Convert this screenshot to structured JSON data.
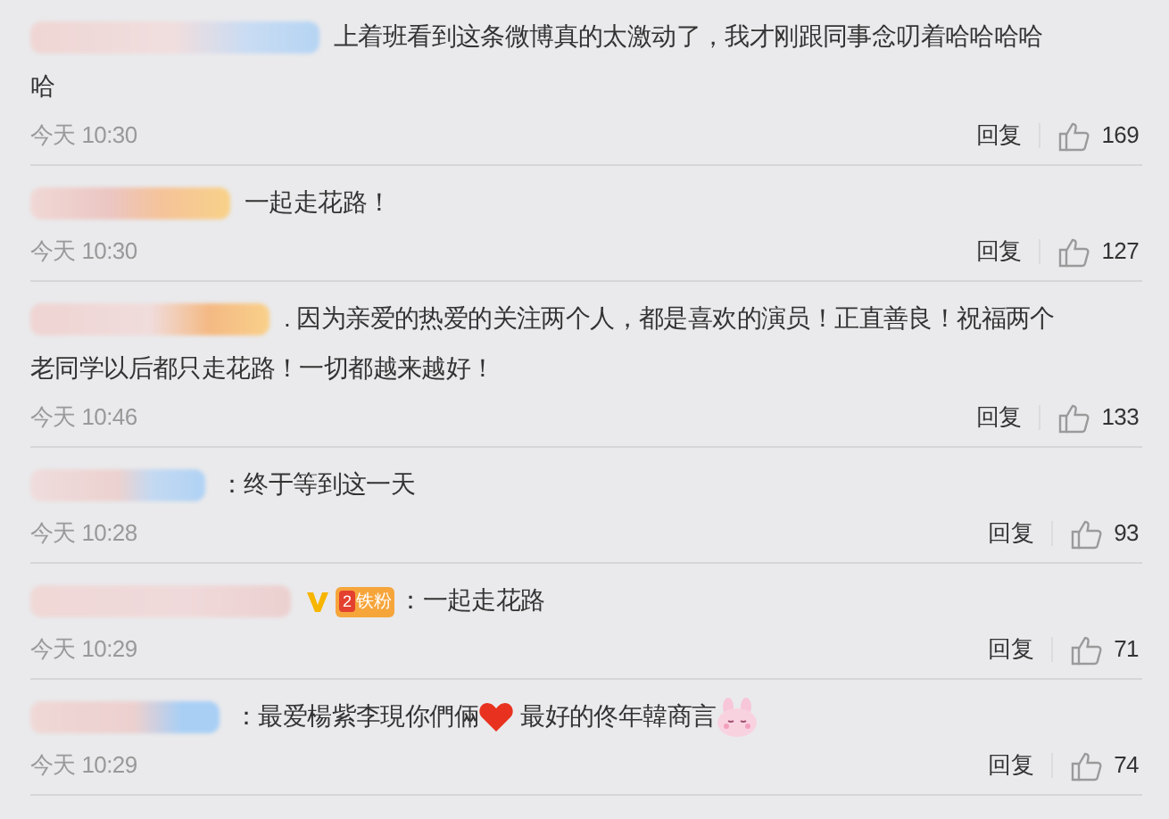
{
  "comments": [
    {
      "parts": [
        {
          "kind": "text",
          "text": "上着班看到这条微博真的太激动了，我才刚跟同事念叨着哈哈哈哈"
        },
        {
          "kind": "break"
        },
        {
          "kind": "text",
          "text": "哈"
        }
      ],
      "time": "今天 10:30",
      "reply": "回复",
      "likes": "169"
    },
    {
      "parts": [
        {
          "kind": "text",
          "text": "一起走花路！"
        }
      ],
      "time": "今天 10:30",
      "reply": "回复",
      "likes": "127"
    },
    {
      "parts": [
        {
          "kind": "text",
          "text": ". 因为亲爱的热爱的关注两个人，都是喜欢的演员！正直善良！祝福两个"
        },
        {
          "kind": "break"
        },
        {
          "kind": "text",
          "text": "老同学以后都只走花路！一切都越来越好！"
        }
      ],
      "time": "今天 10:46",
      "reply": "回复",
      "likes": "133"
    },
    {
      "parts": [
        {
          "kind": "text",
          "text": "：终于等到这一天"
        }
      ],
      "time": "今天 10:28",
      "reply": "回复",
      "likes": "93"
    },
    {
      "badges": [
        {
          "kind": "verified"
        },
        {
          "kind": "fan",
          "level": "2",
          "label": "铁粉"
        }
      ],
      "parts": [
        {
          "kind": "text",
          "text": "：一起走花路"
        }
      ],
      "time": "今天 10:29",
      "reply": "回复",
      "likes": "71"
    },
    {
      "parts": [
        {
          "kind": "text",
          "text": "：最爱楊紫李現你們倆"
        },
        {
          "kind": "heart"
        },
        {
          "kind": "text",
          "text": " 最好的佟年韓商言"
        },
        {
          "kind": "bunny"
        }
      ],
      "time": "今天 10:29",
      "reply": "回复",
      "likes": "74"
    }
  ]
}
